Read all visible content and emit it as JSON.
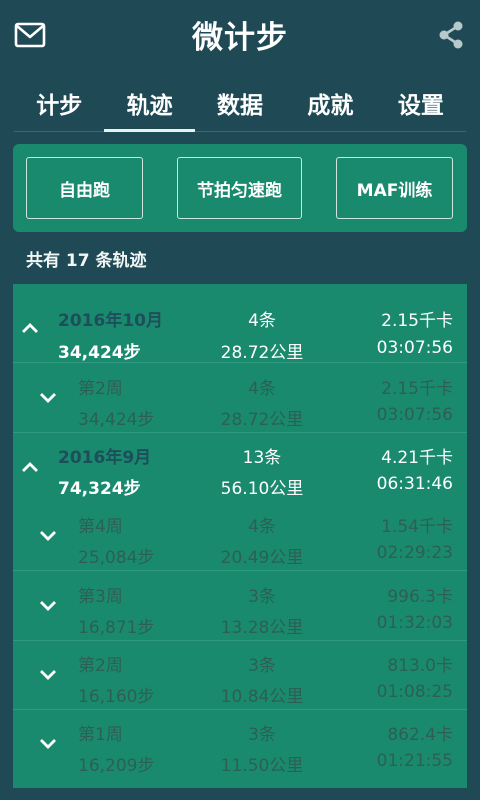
{
  "header": {
    "title": "微计步"
  },
  "tabs": [
    {
      "label": "计步",
      "active": false
    },
    {
      "label": "轨迹",
      "active": true
    },
    {
      "label": "数据",
      "active": false
    },
    {
      "label": "成就",
      "active": false
    },
    {
      "label": "设置",
      "active": false
    }
  ],
  "modes": {
    "free": "自由跑",
    "metronome": "节拍匀速跑",
    "maf": "MAF训练"
  },
  "summary": "共有 17 条轨迹",
  "groups": [
    {
      "month": "2016年10月",
      "count": "4条",
      "calories": "2.15千卡",
      "steps": "34,424步",
      "distance": "28.72公里",
      "duration": "03:07:56",
      "weeks": [
        {
          "week": "第2周",
          "count": "4条",
          "calories": "2.15千卡",
          "steps": "34,424步",
          "distance": "28.72公里",
          "duration": "03:07:56"
        }
      ]
    },
    {
      "month": "2016年9月",
      "count": "13条",
      "calories": "4.21千卡",
      "steps": "74,324步",
      "distance": "56.10公里",
      "duration": "06:31:46",
      "weeks": [
        {
          "week": "第4周",
          "count": "4条",
          "calories": "1.54千卡",
          "steps": "25,084步",
          "distance": "20.49公里",
          "duration": "02:29:23"
        },
        {
          "week": "第3周",
          "count": "3条",
          "calories": "996.3卡",
          "steps": "16,871步",
          "distance": "13.28公里",
          "duration": "01:32:03"
        },
        {
          "week": "第2周",
          "count": "3条",
          "calories": "813.0卡",
          "steps": "16,160步",
          "distance": "10.84公里",
          "duration": "01:08:25"
        },
        {
          "week": "第1周",
          "count": "3条",
          "calories": "862.4卡",
          "steps": "16,209步",
          "distance": "11.50公里",
          "duration": "01:21:55"
        }
      ]
    }
  ],
  "icons": {
    "mail": "mail-icon",
    "share": "share-icon",
    "expanded": "chevron-up-icon",
    "collapsed": "chevron-down-icon"
  },
  "colors": {
    "background": "#1f4a55",
    "accent": "#1a8a6e",
    "month_text": "#1d4e5a",
    "week_text": "#2d5f55"
  }
}
